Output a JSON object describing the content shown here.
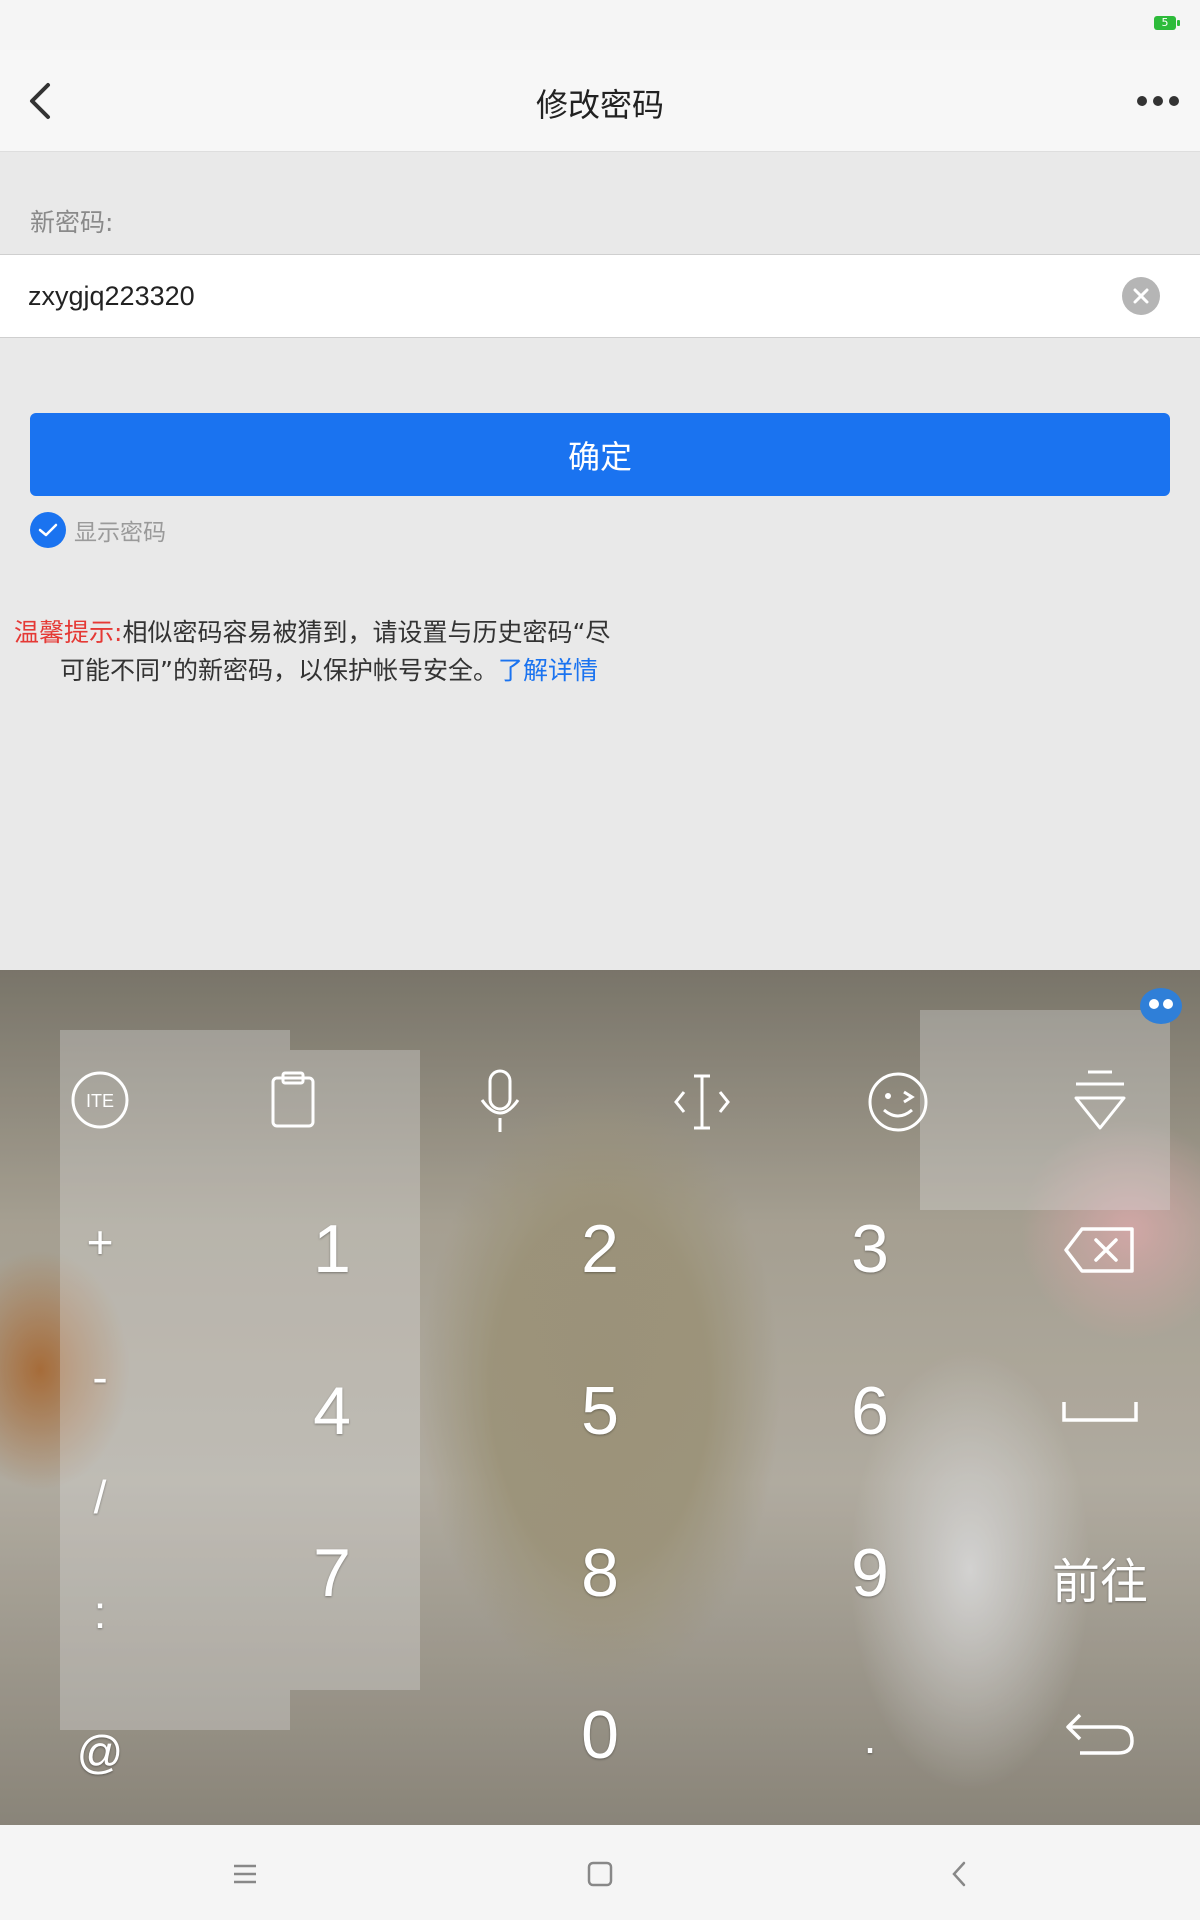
{
  "status_bar": {
    "battery": "5"
  },
  "header": {
    "title": "修改密码",
    "back_icon": "chevron-left-icon",
    "more_icon": "more-horizontal-icon"
  },
  "form": {
    "new_password_label": "新密码:",
    "new_password_value": "zxygjq223320",
    "clear_icon": "clear-circle-icon",
    "confirm_label": "确定",
    "show_password_label": "显示密码",
    "show_password_checked": true
  },
  "tip": {
    "label": "温馨提示:",
    "line1": "相似密码容易被猜到，请设置与历史密码“尽",
    "line2": "可能不同”的新密码，以保护帐号安全。",
    "link": "了解详情"
  },
  "keyboard": {
    "toolbar": [
      "keyboard-layout-icon",
      "clipboard-icon",
      "microphone-icon",
      "cursor-icon",
      "emoji-icon",
      "hide-keyboard-icon"
    ],
    "symbols": [
      "+",
      "-",
      "/",
      ":",
      "@"
    ],
    "digits": [
      "1",
      "2",
      "3",
      "4",
      "5",
      "6",
      "7",
      "8",
      "9",
      "0"
    ],
    "dot": ".",
    "go_label": "前往"
  },
  "colors": {
    "accent": "#1a73f0",
    "tip_red": "#e53935"
  }
}
